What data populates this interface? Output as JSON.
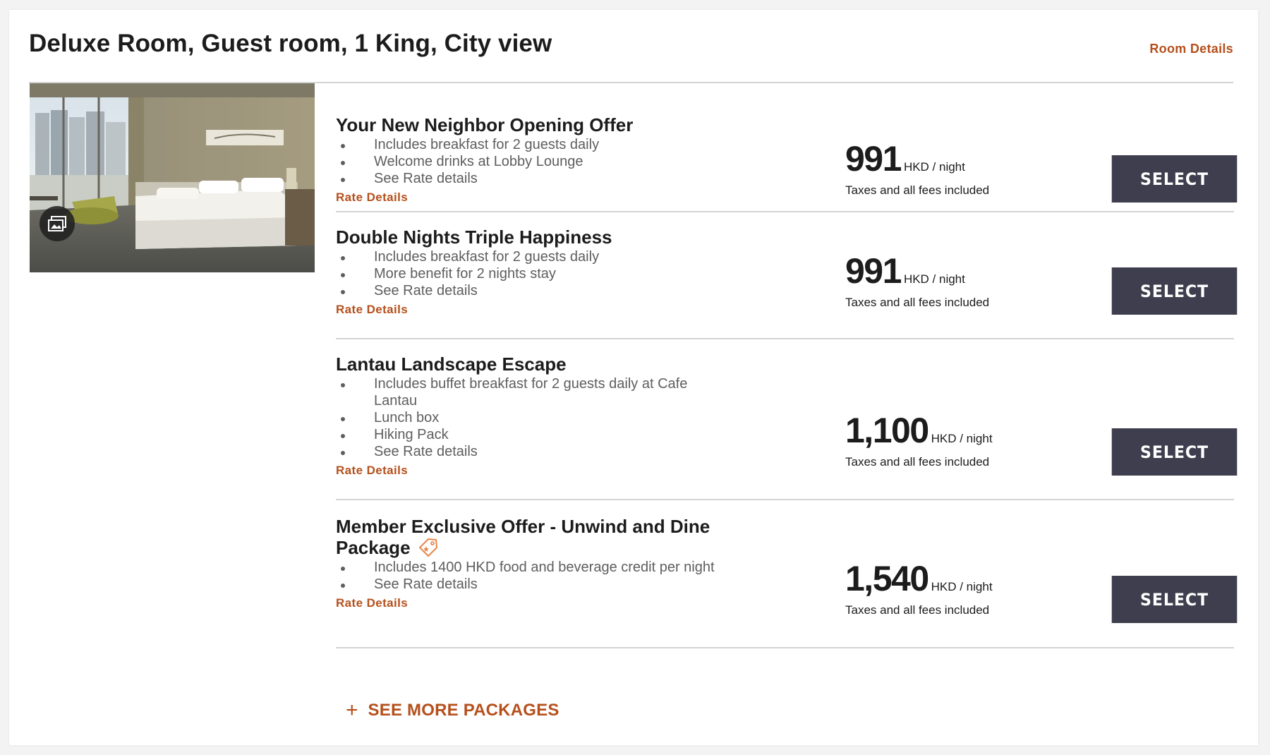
{
  "room": {
    "title": "Deluxe Room, Guest room, 1 King, City view",
    "details_link": "Room Details",
    "gallery_icon": "photo-gallery-icon"
  },
  "rates": [
    {
      "name": "Your New Neighbor Opening Offer",
      "perks": [
        "Includes breakfast for 2 guests daily",
        "Welcome drinks at Lobby Lounge",
        "See Rate details"
      ],
      "rate_details_link": "Rate Details",
      "price": "991",
      "unit": "HKD / night",
      "note": "Taxes and all fees included",
      "select_label": "SELECT",
      "member_tag": false
    },
    {
      "name": "Double Nights Triple Happiness",
      "perks": [
        "Includes breakfast for 2 guests daily",
        "More benefit for 2 nights stay",
        "See Rate details"
      ],
      "rate_details_link": "Rate Details",
      "price": "991",
      "unit": "HKD / night",
      "note": "Taxes and all fees included",
      "select_label": "SELECT",
      "member_tag": false
    },
    {
      "name": "Lantau Landscape Escape",
      "perks": [
        "Includes buffet breakfast for 2 guests daily at Cafe Lantau",
        "Lunch box",
        "Hiking Pack",
        "See Rate details"
      ],
      "rate_details_link": "Rate Details",
      "price": "1,100",
      "unit": "HKD / night",
      "note": "Taxes and all fees included",
      "select_label": "SELECT",
      "member_tag": false
    },
    {
      "name": "Member Exclusive Offer - Unwind and Dine Package",
      "perks": [
        "Includes 1400 HKD food and beverage credit per night",
        "See Rate details"
      ],
      "rate_details_link": "Rate Details",
      "price": "1,540",
      "unit": "HKD / night",
      "note": "Taxes and all fees included",
      "select_label": "SELECT",
      "member_tag": true,
      "member_tag_icon": "member-tag-icon"
    }
  ],
  "see_more": {
    "label": "SEE MORE PACKAGES",
    "icon": "plus-icon"
  },
  "colors": {
    "accent": "#b5501c",
    "button": "#3e3e4e",
    "divider": "#d4d4d4"
  }
}
